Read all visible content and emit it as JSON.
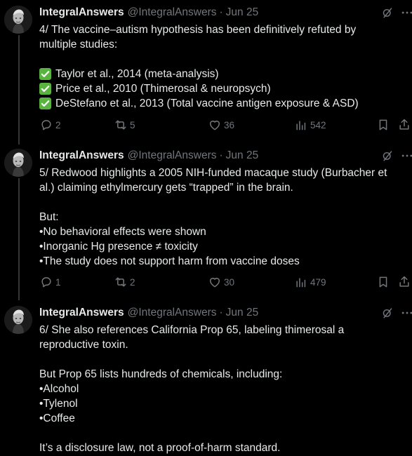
{
  "tweets": [
    {
      "name": "IntegralAnswers",
      "handle": "@IntegralAnswers",
      "separator": "·",
      "time": "Jun 25",
      "lines": [
        "4/ The vaccine–autism hypothesis has been definitively refuted by",
        "multiple studies:",
        "",
        "Taylor et al., 2014 (meta-analysis)",
        "Price et al., 2010 (Thimerosal & neuropsych)",
        "DeStefano et al., 2013 (Total vaccine antigen exposure & ASD)"
      ],
      "replies": "2",
      "retweets": "5",
      "likes": "36",
      "views": "542"
    },
    {
      "name": "IntegralAnswers",
      "handle": "@IntegralAnswers",
      "separator": "·",
      "time": "Jun 25",
      "lines": [
        "5/ Redwood highlights a 2005 NIH-funded macaque study (Burbacher et",
        "al.) claiming ethylmercury gets “trapped” in the brain.",
        "",
        "But:",
        "•No behavioral effects were shown",
        "•Inorganic Hg presence ≠ toxicity",
        "•The study does not support harm from vaccine doses"
      ],
      "replies": "1",
      "retweets": "2",
      "likes": "30",
      "views": "479"
    },
    {
      "name": "IntegralAnswers",
      "handle": "@IntegralAnswers",
      "separator": "·",
      "time": "Jun 25",
      "lines": [
        "6/ She also references California Prop 65, labeling thimerosal a",
        "reproductive toxin.",
        "",
        "But Prop 65 lists hundreds of chemicals, including:",
        "•Alcohol",
        "•Tylenol",
        "•Coffee",
        "",
        "It’s a disclosure law, not a proof-of-harm standard."
      ]
    }
  ],
  "icons": {
    "checkmark": "white-check-mark-icon",
    "reply": "speech-bubble-icon",
    "retweet": "retweet-icon",
    "like": "heart-icon",
    "views": "bar-chart-icon",
    "bookmark": "bookmark-icon",
    "share": "share-icon",
    "grok": "grok-icon",
    "more": "more-icon"
  },
  "colors": {
    "background": "#000000",
    "text": "#e7e9ea",
    "muted": "#71767b",
    "thread_line": "#333639",
    "check": "#59b33f"
  }
}
